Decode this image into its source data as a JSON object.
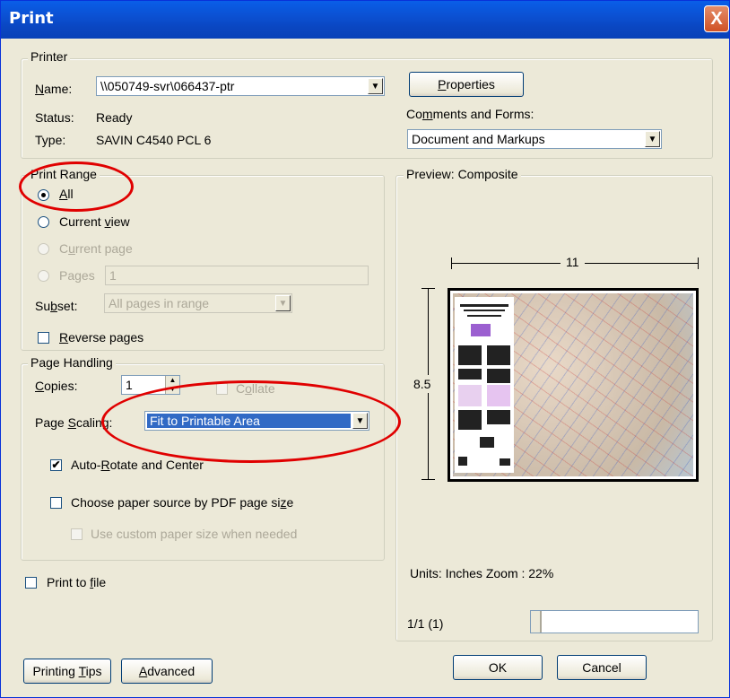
{
  "window": {
    "title": "Print",
    "close_glyph": "X"
  },
  "printer": {
    "group_label": "Printer",
    "name_label": "Name:",
    "name_value": "\\\\050749-svr\\066437-ptr",
    "status_label": "Status:",
    "status_value": "Ready",
    "type_label": "Type:",
    "type_value": "SAVIN C4540 PCL 6",
    "properties_button": "Properties",
    "comments_label": "Comments and Forms:",
    "comments_value": "Document and Markups"
  },
  "print_range": {
    "group_label": "Print Range",
    "options": [
      {
        "label": "All",
        "selected": true,
        "enabled": true
      },
      {
        "label": "Current view",
        "selected": false,
        "enabled": true
      },
      {
        "label": "Current page",
        "selected": false,
        "enabled": false
      },
      {
        "label": "Pages",
        "selected": false,
        "enabled": false
      }
    ],
    "pages_value": "1",
    "subset_label": "Subset:",
    "subset_value": "All pages in range",
    "reverse_label": "Reverse pages"
  },
  "page_handling": {
    "group_label": "Page Handling",
    "copies_label": "Copies:",
    "copies_value": "1",
    "collate_label": "Collate",
    "scaling_label": "Page Scaling:",
    "scaling_value": "Fit to Printable Area",
    "autorotate_label": "Auto-Rotate and Center",
    "autorotate_checked": true,
    "paper_source_label": "Choose paper source by PDF page size",
    "custom_paper_label": "Use custom paper size when needed"
  },
  "print_to_file_label": "Print to file",
  "preview": {
    "group_label": "Preview: Composite",
    "width_label": "11",
    "height_label": "8.5",
    "units_zoom": "Units: Inches Zoom :  22%",
    "page_indicator": "1/1 (1)"
  },
  "buttons": {
    "printing_tips": "Printing Tips",
    "advanced": "Advanced",
    "ok": "OK",
    "cancel": "Cancel"
  },
  "colors": {
    "annotation": "#e00000",
    "titlebar": "#0a5ee8",
    "selection": "#316ac5"
  }
}
